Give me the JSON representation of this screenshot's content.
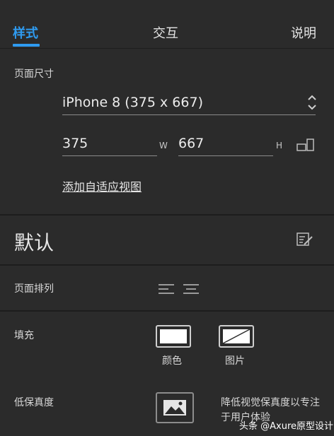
{
  "tabs": {
    "style": "样式",
    "interaction": "交互",
    "notes": "说明"
  },
  "page_size": {
    "section_label": "页面尺寸",
    "device_select": "iPhone 8  (375 x 667)",
    "width_value": "375",
    "width_unit": "W",
    "height_value": "667",
    "height_unit": "H",
    "add_adaptive_view": "添加自适应视图"
  },
  "default_section": {
    "title": "默认"
  },
  "page_arrangement": {
    "label": "页面排列"
  },
  "fill": {
    "label": "填充",
    "color_label": "颜色",
    "image_label": "图片"
  },
  "low_fidelity": {
    "label": "低保真度",
    "description_line1": "降低视觉保真度以专注",
    "description_line2": "于用户体验"
  },
  "watermark": {
    "text": "头条 @Axure原型设计"
  },
  "colors": {
    "background": "#2b2b2b",
    "accent": "#2f9bf0",
    "text": "#e6e6e6"
  }
}
